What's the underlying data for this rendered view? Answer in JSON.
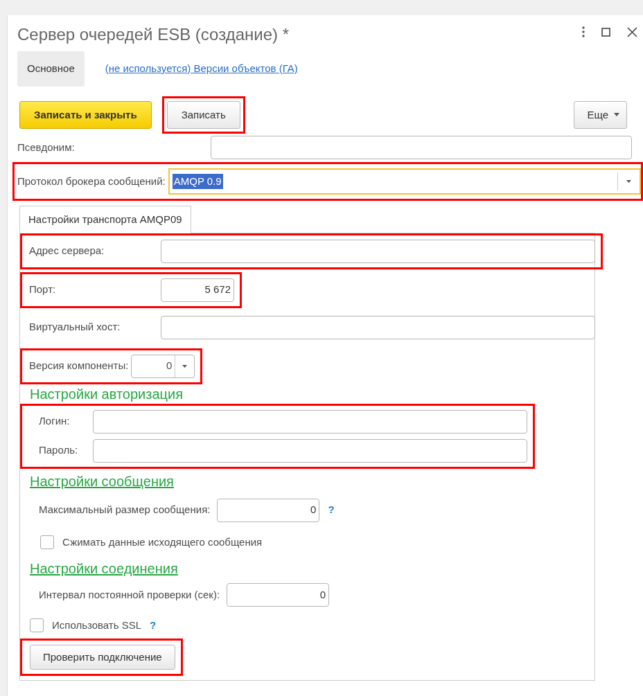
{
  "window": {
    "title": "Сервер очередей ESB (создание) *"
  },
  "form_tabs": [
    {
      "label": "Основное",
      "selected": true
    },
    {
      "label": "(не используется) Версии объектов (ГА)",
      "selected": false
    }
  ],
  "commands": [
    {
      "label": "Записать и закрыть",
      "kind": "primary",
      "highlighted": false
    },
    {
      "label": "Записать",
      "kind": "default",
      "highlighted": true
    },
    {
      "label": "Еще",
      "kind": "menu",
      "highlighted": false
    }
  ],
  "alias": {
    "label": "Псевдоним:",
    "highlighted": false
  },
  "protocol": {
    "label": "Протокол брокера сообщений:",
    "value": "AMQP 0.9",
    "focused": true,
    "highlighted": true
  },
  "panel": {
    "tab": {
      "label": "Настройки транспорта AMQP09",
      "selected": true
    },
    "items": [
      {
        "kind": "group",
        "highlighted": true,
        "indented": false,
        "rows": [
          {
            "kind": "text",
            "label": "Адрес сервера:"
          }
        ]
      },
      {
        "kind": "group",
        "highlighted": true,
        "indented": false,
        "rows": [
          {
            "kind": "number",
            "label": "Порт:",
            "value": "5 672"
          }
        ]
      },
      {
        "kind": "group",
        "highlighted": false,
        "indented": false,
        "rows": [
          {
            "kind": "text",
            "label": "Виртуальный хост:"
          }
        ]
      },
      {
        "kind": "group",
        "highlighted": true,
        "indented": false,
        "rows": [
          {
            "kind": "select",
            "label": "Версия компоненты:",
            "value": "0"
          }
        ]
      },
      {
        "kind": "heading",
        "text": "Настройки авторизация",
        "underlined": false
      },
      {
        "kind": "group",
        "highlighted": true,
        "indented": true,
        "rows": [
          {
            "kind": "text",
            "label": "Логин:"
          },
          {
            "kind": "text",
            "label": "Пароль:"
          }
        ]
      },
      {
        "kind": "heading",
        "text": "Настройки сообщения",
        "underlined": true
      },
      {
        "kind": "group",
        "highlighted": false,
        "indented": true,
        "rows": [
          {
            "kind": "number",
            "label": "Максимальный размер сообщения:",
            "value": "0",
            "help": "?"
          }
        ]
      },
      {
        "kind": "group",
        "highlighted": false,
        "indented": true,
        "rows": [
          {
            "kind": "checkbox",
            "label": "Сжимать данные исходящего сообщения",
            "checked": false
          }
        ]
      },
      {
        "kind": "heading",
        "text": "Настройки соединения",
        "underlined": true
      },
      {
        "kind": "group",
        "highlighted": false,
        "indented": true,
        "rows": [
          {
            "kind": "number",
            "label": "Интервал постоянной проверки (сек):",
            "value": "0"
          }
        ]
      },
      {
        "kind": "group",
        "highlighted": false,
        "indented": false,
        "rows": [
          {
            "kind": "checkbox",
            "label": "Использовать SSL",
            "checked": false,
            "help": "?"
          }
        ]
      },
      {
        "kind": "group",
        "highlighted": true,
        "indented": false,
        "rows": [
          {
            "kind": "button",
            "label": "Проверить подключение"
          }
        ]
      }
    ]
  }
}
